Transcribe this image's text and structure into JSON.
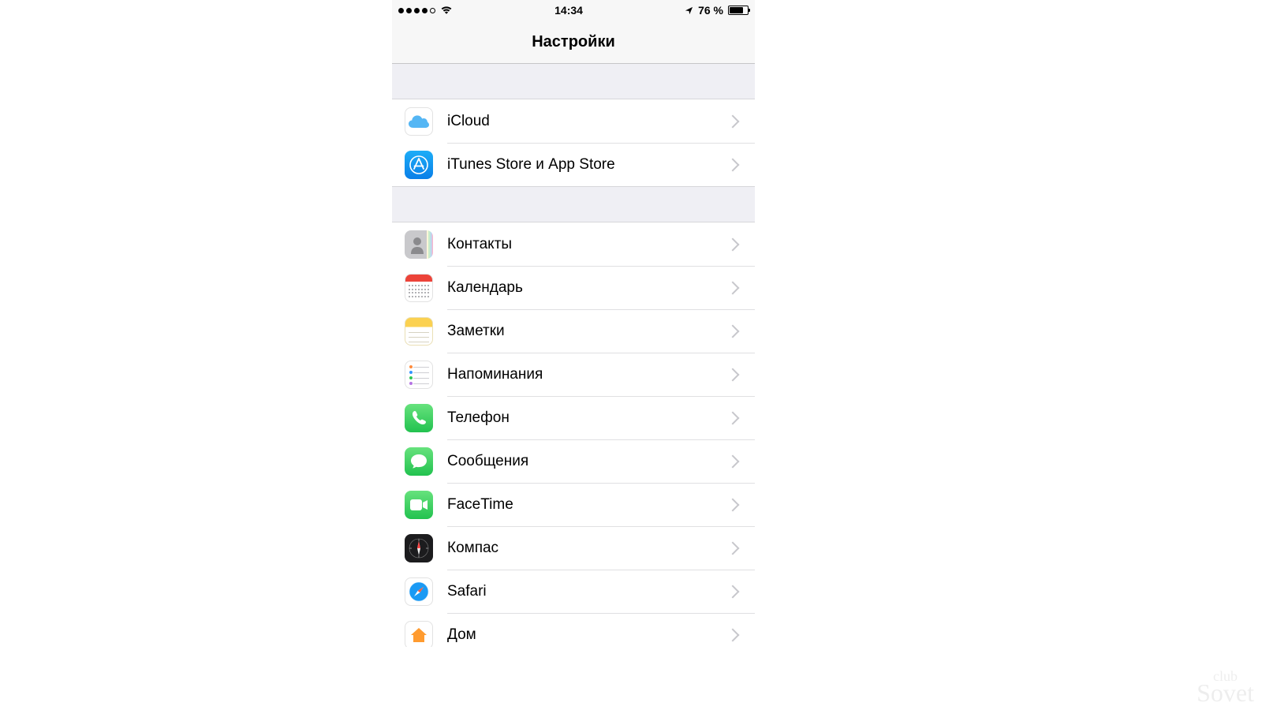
{
  "status": {
    "time": "14:34",
    "battery_pct": "76 %",
    "battery_fill_pct": 76
  },
  "nav": {
    "title": "Настройки"
  },
  "groups": [
    {
      "items": [
        {
          "id": "icloud",
          "label": "iCloud",
          "icon": "icloud"
        },
        {
          "id": "itunes",
          "label": "iTunes Store и App Store",
          "icon": "appstore"
        }
      ]
    },
    {
      "items": [
        {
          "id": "contacts",
          "label": "Контакты",
          "icon": "contacts"
        },
        {
          "id": "calendar",
          "label": "Календарь",
          "icon": "calendar"
        },
        {
          "id": "notes",
          "label": "Заметки",
          "icon": "notes"
        },
        {
          "id": "reminders",
          "label": "Напоминания",
          "icon": "reminders"
        },
        {
          "id": "phone",
          "label": "Телефон",
          "icon": "phone"
        },
        {
          "id": "messages",
          "label": "Сообщения",
          "icon": "messages"
        },
        {
          "id": "facetime",
          "label": "FaceTime",
          "icon": "facetime"
        },
        {
          "id": "compass",
          "label": "Компас",
          "icon": "compass"
        },
        {
          "id": "safari",
          "label": "Safari",
          "icon": "safari"
        },
        {
          "id": "home",
          "label": "Дом",
          "icon": "home"
        }
      ]
    }
  ],
  "watermark": {
    "line1": "club",
    "line2": "Sovet"
  }
}
